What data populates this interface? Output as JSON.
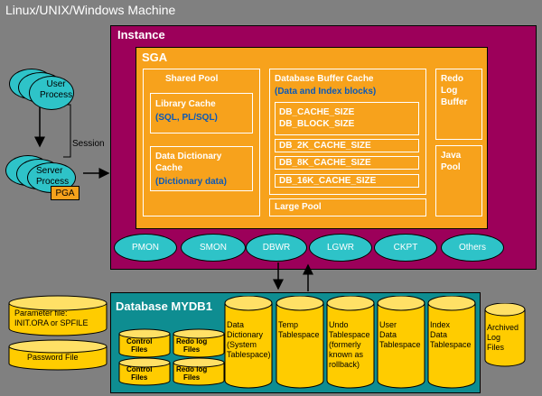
{
  "machine": {
    "title": "Linux/UNIX/Windows Machine"
  },
  "instance": {
    "title": "Instance"
  },
  "sga": {
    "title": "SGA",
    "shared_pool": {
      "title": "Shared Pool",
      "library_cache": {
        "title": "Library Cache",
        "subtitle": "(SQL, PL/SQL)"
      },
      "data_dictionary_cache": {
        "title_line1": "Data Dictionary",
        "title_line2": "Cache",
        "subtitle": "(Dictionary data)"
      }
    },
    "buffer_cache": {
      "title": "Database Buffer Cache",
      "subtitle": "(Data and Index blocks)",
      "params": [
        "DB_CACHE_SIZE",
        "DB_BLOCK_SIZE",
        "DB_2K_CACHE_SIZE",
        "DB_8K_CACHE_SIZE",
        "DB_16K_CACHE_SIZE"
      ]
    },
    "large_pool": "Large Pool",
    "redo_log_buffer": [
      "Redo",
      "Log",
      "Buffer"
    ],
    "java_pool": [
      "Java",
      "Pool"
    ]
  },
  "processes": [
    "PMON",
    "SMON",
    "DBWR",
    "LGWR",
    "CKPT",
    "Others"
  ],
  "user_process": {
    "line1": "User",
    "line2": "Process"
  },
  "server_process": {
    "line1": "Server",
    "line2": "Process"
  },
  "pga": "PGA",
  "session": "Session",
  "parameter_file": {
    "line1": "Parameter file:",
    "line2": "INIT.ORA or SPFILE"
  },
  "password_file": "Password File",
  "database": {
    "title": "Database MYDB1",
    "control_files": [
      "Control",
      "Files"
    ],
    "redo_log_files": [
      "Redo log",
      "Files"
    ],
    "tablespaces": [
      [
        "Data",
        "Dictionary",
        "(System",
        "Tablespace)"
      ],
      [
        "Temp",
        "Tablespace"
      ],
      [
        "Undo",
        "Tablespace",
        "(formerly",
        "known as",
        "rollback)"
      ],
      [
        "User",
        "Data",
        "Tablespace"
      ],
      [
        "Index",
        "Data",
        "Tablespace"
      ]
    ]
  },
  "archived_log_files": [
    "Archived",
    "Log",
    "Files"
  ],
  "colors": {
    "background": "#808080",
    "instance": "#9c005a",
    "sga": "#f7a21c",
    "process": "#2ec3c8",
    "database": "#0e8d91",
    "cylinder": "#ffcc00",
    "blue_text": "#0b59b7"
  }
}
